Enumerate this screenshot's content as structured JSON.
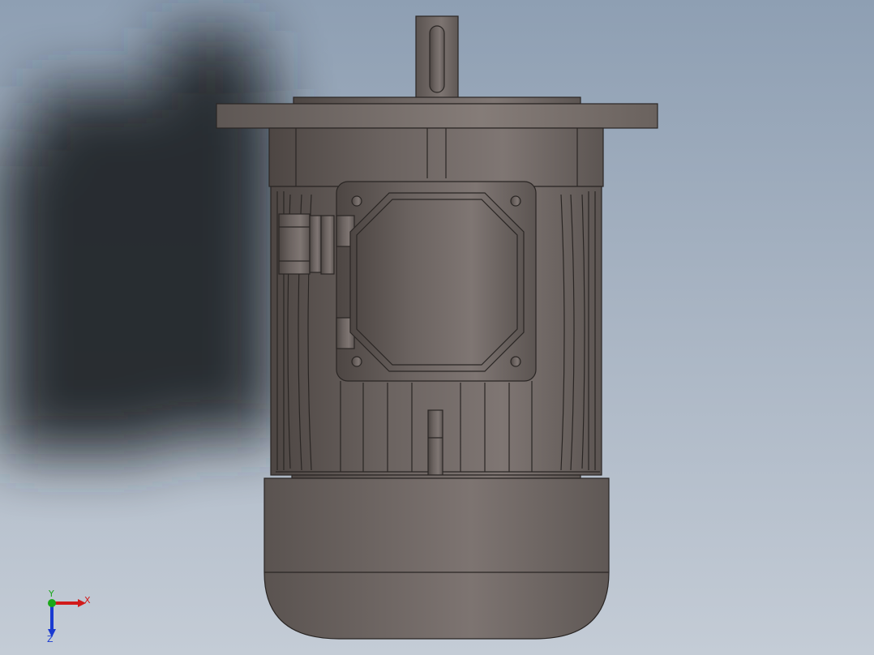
{
  "viewport": {
    "background_top": "#8e9fb3",
    "background_bottom": "#c4ccd6",
    "model_color": "#6a625e",
    "edge_color": "#2a2624",
    "shadow_color": "#2c2f33"
  },
  "triad": {
    "x_label": "X",
    "y_label": "Y",
    "z_label": "Z",
    "x_color": "#d11a1a",
    "y_color": "#1aa81a",
    "z_color": "#1a3ad1"
  }
}
